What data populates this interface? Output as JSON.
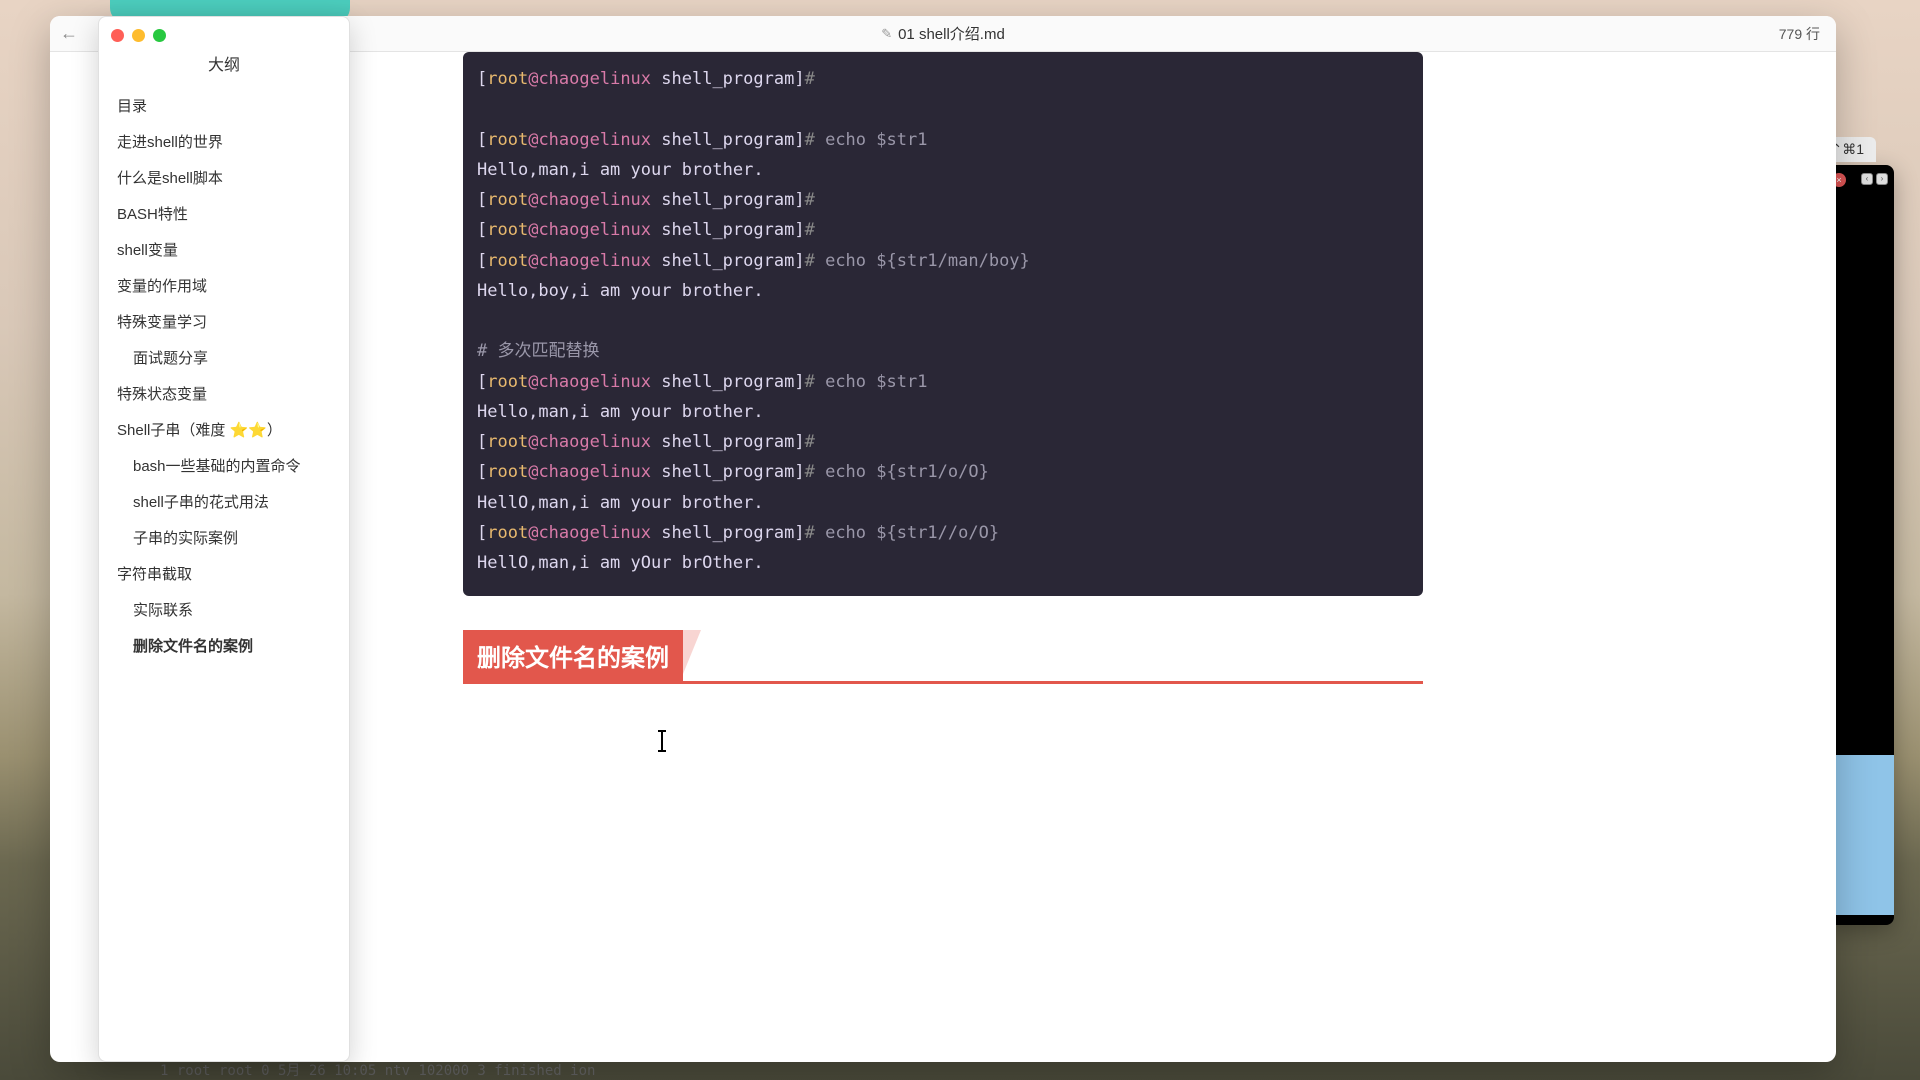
{
  "window": {
    "title": "01 shell介绍.md",
    "line_count_label": "779 行"
  },
  "outline": {
    "title": "大纲",
    "items": [
      {
        "label": "目录",
        "level": 1,
        "active": false
      },
      {
        "label": "走进shell的世界",
        "level": 1,
        "active": false
      },
      {
        "label": "什么是shell脚本",
        "level": 1,
        "active": false
      },
      {
        "label": "BASH特性",
        "level": 1,
        "active": false
      },
      {
        "label": "shell变量",
        "level": 1,
        "active": false
      },
      {
        "label": "变量的作用域",
        "level": 1,
        "active": false
      },
      {
        "label": "特殊变量学习",
        "level": 1,
        "active": false
      },
      {
        "label": "面试题分享",
        "level": 2,
        "active": false
      },
      {
        "label": "特殊状态变量",
        "level": 1,
        "active": false
      },
      {
        "label": "Shell子串（难度 ⭐⭐）",
        "level": 1,
        "active": false
      },
      {
        "label": "bash一些基础的内置命令",
        "level": 2,
        "active": false
      },
      {
        "label": "shell子串的花式用法",
        "level": 2,
        "active": false
      },
      {
        "label": "子串的实际案例",
        "level": 2,
        "active": false
      },
      {
        "label": "字符串截取",
        "level": 1,
        "active": false
      },
      {
        "label": "实际联系",
        "level": 2,
        "active": false
      },
      {
        "label": "删除文件名的案例",
        "level": 2,
        "active": true
      }
    ]
  },
  "code": {
    "prompt_user": "root",
    "prompt_host": "@chaogelinux",
    "prompt_path": " shell_program",
    "lines": [
      {
        "type": "prompt",
        "cmd": ""
      },
      {
        "type": "blank"
      },
      {
        "type": "prompt",
        "cmd": "echo $str1"
      },
      {
        "type": "out",
        "text": "Hello,man,i am your brother."
      },
      {
        "type": "prompt",
        "cmd": ""
      },
      {
        "type": "prompt",
        "cmd": ""
      },
      {
        "type": "prompt",
        "cmd": "echo ${str1/man/boy}"
      },
      {
        "type": "out",
        "text": "Hello,boy,i am your brother."
      },
      {
        "type": "blank"
      },
      {
        "type": "comment",
        "text": "# 多次匹配替换"
      },
      {
        "type": "prompt",
        "cmd": "echo $str1"
      },
      {
        "type": "out",
        "text": "Hello,man,i am your brother."
      },
      {
        "type": "prompt",
        "cmd": ""
      },
      {
        "type": "prompt",
        "cmd": "echo ${str1/o/O}"
      },
      {
        "type": "out",
        "text": "HellO,man,i am your brother."
      },
      {
        "type": "prompt",
        "cmd": "echo ${str1//o/O}"
      },
      {
        "type": "out",
        "text": "HellO,man,i am yOur brOther."
      }
    ]
  },
  "heading": {
    "text": "删除文件名的案例"
  },
  "bg_terminal": {
    "title": "⌃⌘1"
  },
  "bottom_peek": "1 root root 0 5月  26 10:05 ntv 102000 3 finished ion"
}
